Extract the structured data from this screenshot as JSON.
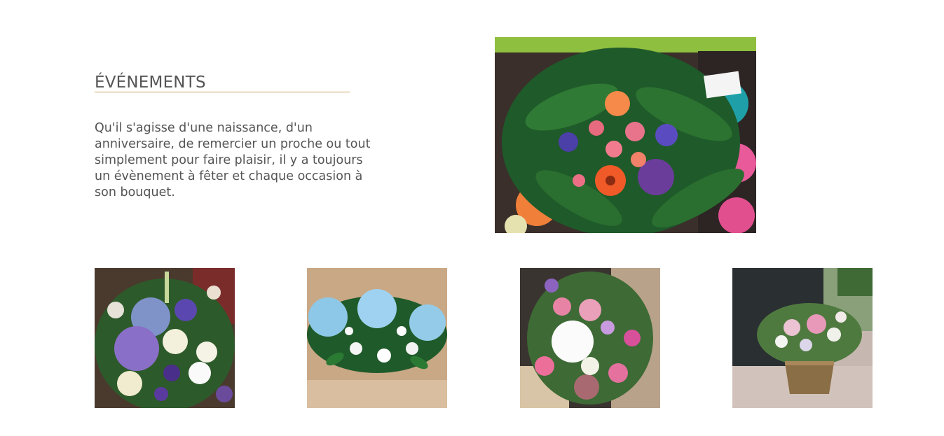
{
  "section": {
    "title": "ÉVÉNEMENTS",
    "text": "Qu'il s'agisse d'une naissance, d'un anniversaire, de remercier un proche ou tout simplement pour faire plaisir, il y a toujours un évènement à fêter et chaque occasion à son bouquet.",
    "accent_color": "#c9a15e"
  },
  "gallery": {
    "main_photo": {
      "alt": "bouquet-coloré"
    },
    "thumbnails": [
      {
        "alt": "bouquet-violet-blanc"
      },
      {
        "alt": "composition-hortensia-bleu"
      },
      {
        "alt": "bouquet-rose-blanc"
      },
      {
        "alt": "panier-fleuri"
      }
    ]
  }
}
